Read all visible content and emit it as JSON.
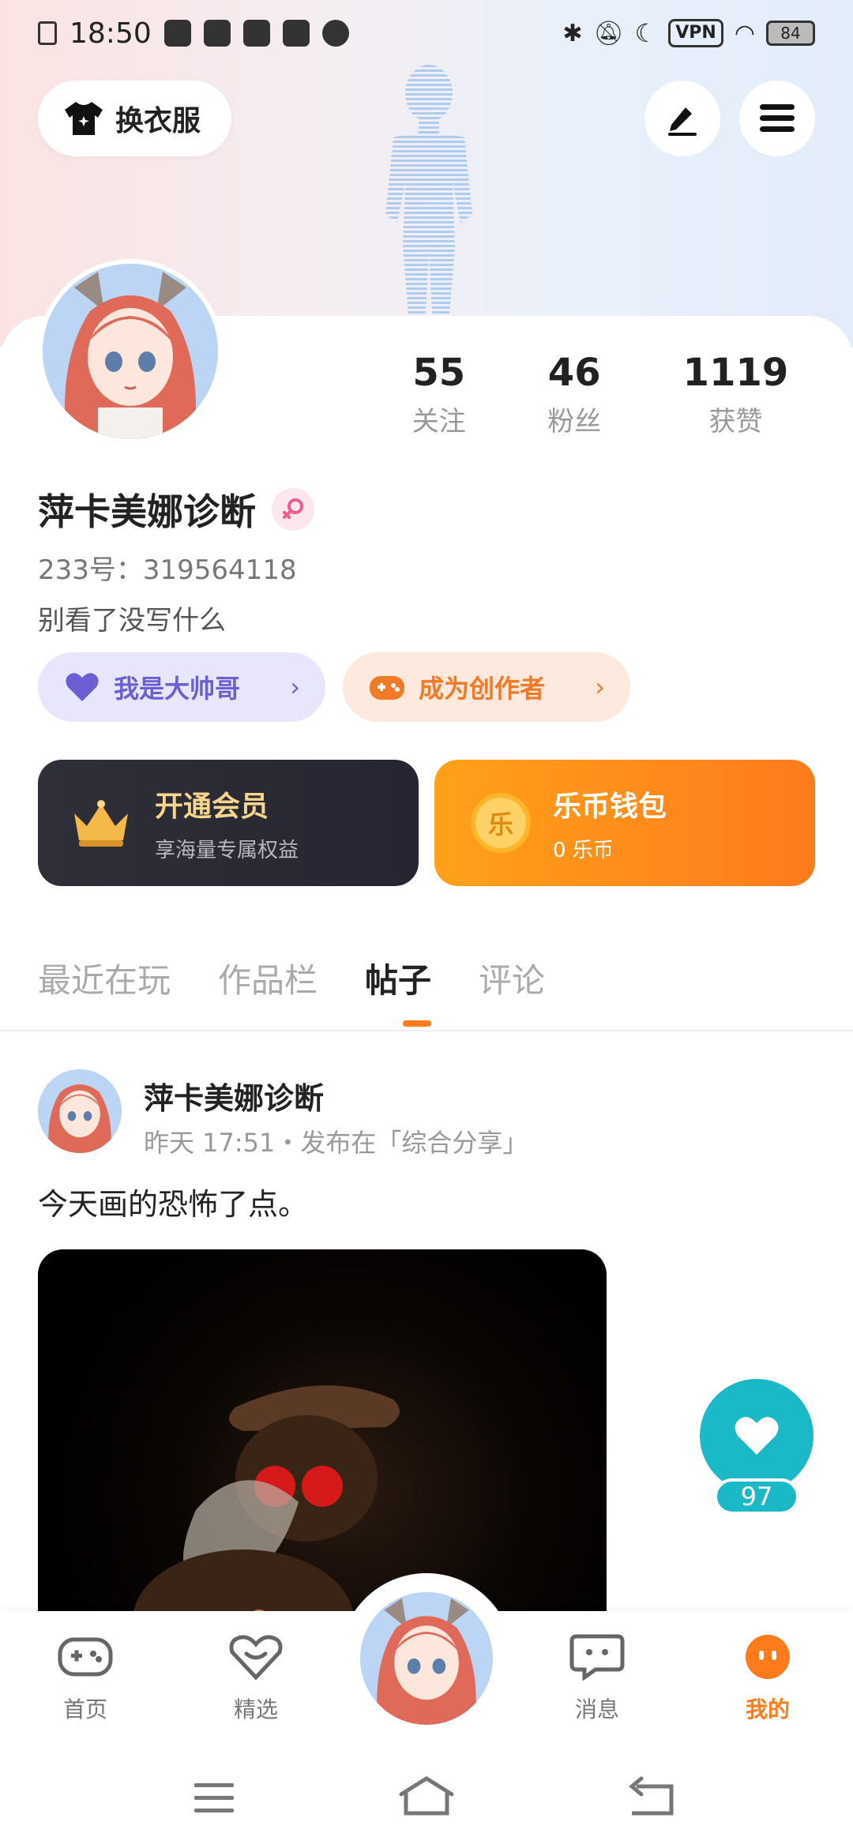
{
  "status_bar": {
    "time": "18:50",
    "vpn_label": "VPN",
    "battery": "84"
  },
  "top_actions": {
    "outfit_label": "换衣服"
  },
  "profile": {
    "stats": [
      {
        "value": "55",
        "label": "关注"
      },
      {
        "value": "46",
        "label": "粉丝"
      },
      {
        "value": "1119",
        "label": "获赞"
      }
    ],
    "username": "萍卡美娜诊断",
    "uid": "233号：319564118",
    "bio": "别看了没写什么",
    "badges": [
      {
        "label": "我是大帅哥"
      },
      {
        "label": "成为创作者"
      }
    ]
  },
  "cards": {
    "vip": {
      "title": "开通会员",
      "subtitle": "享海量专属权益"
    },
    "wallet": {
      "title": "乐币钱包",
      "subtitle": "0 乐币",
      "coin_char": "乐"
    }
  },
  "tabs": [
    "最近在玩",
    "作品栏",
    "帖子",
    "评论"
  ],
  "active_tab": "帖子",
  "post": {
    "author": "萍卡美娜诊断",
    "meta": "昨天 17:51・发布在「综合分享」",
    "text": "今天画的恐怖了点。",
    "like_count": "97"
  },
  "bottom_nav": [
    {
      "label": "首页"
    },
    {
      "label": "精选"
    },
    {
      "label": "消息"
    },
    {
      "label": "我的"
    }
  ],
  "colors": {
    "accent": "#ff7b1c",
    "like": "#1bb8c7",
    "purple": "#6b5fd3"
  }
}
